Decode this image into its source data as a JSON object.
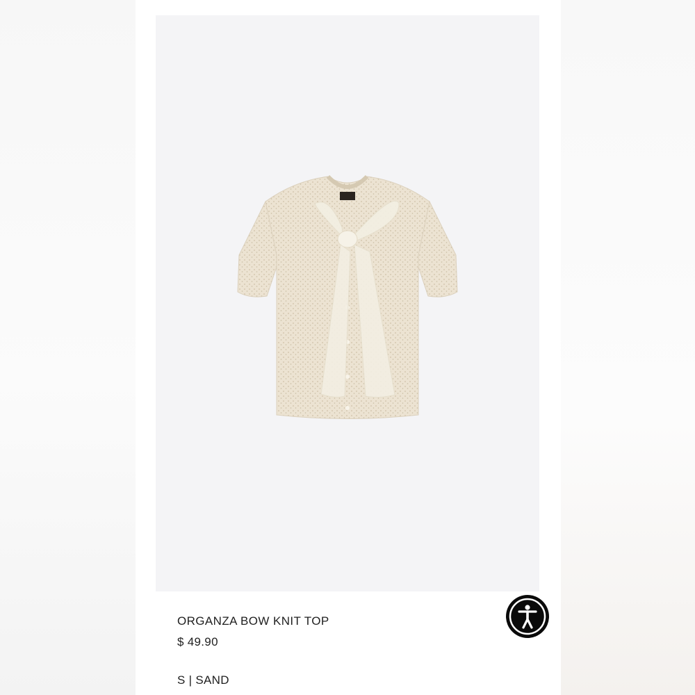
{
  "product": {
    "title": "ORGANZA BOW KNIT TOP",
    "price": "$ 49.90",
    "variant": "S | SAND",
    "image_alt": "Sand knit short-sleeve top with organza bow",
    "colors": {
      "knit": "#ece3d2",
      "bow": "#f3efe3",
      "photo_bg": "#f4f4f6"
    }
  },
  "accessibility_button": {
    "icon": "accessibility-icon",
    "color": "#0a0a0a"
  }
}
